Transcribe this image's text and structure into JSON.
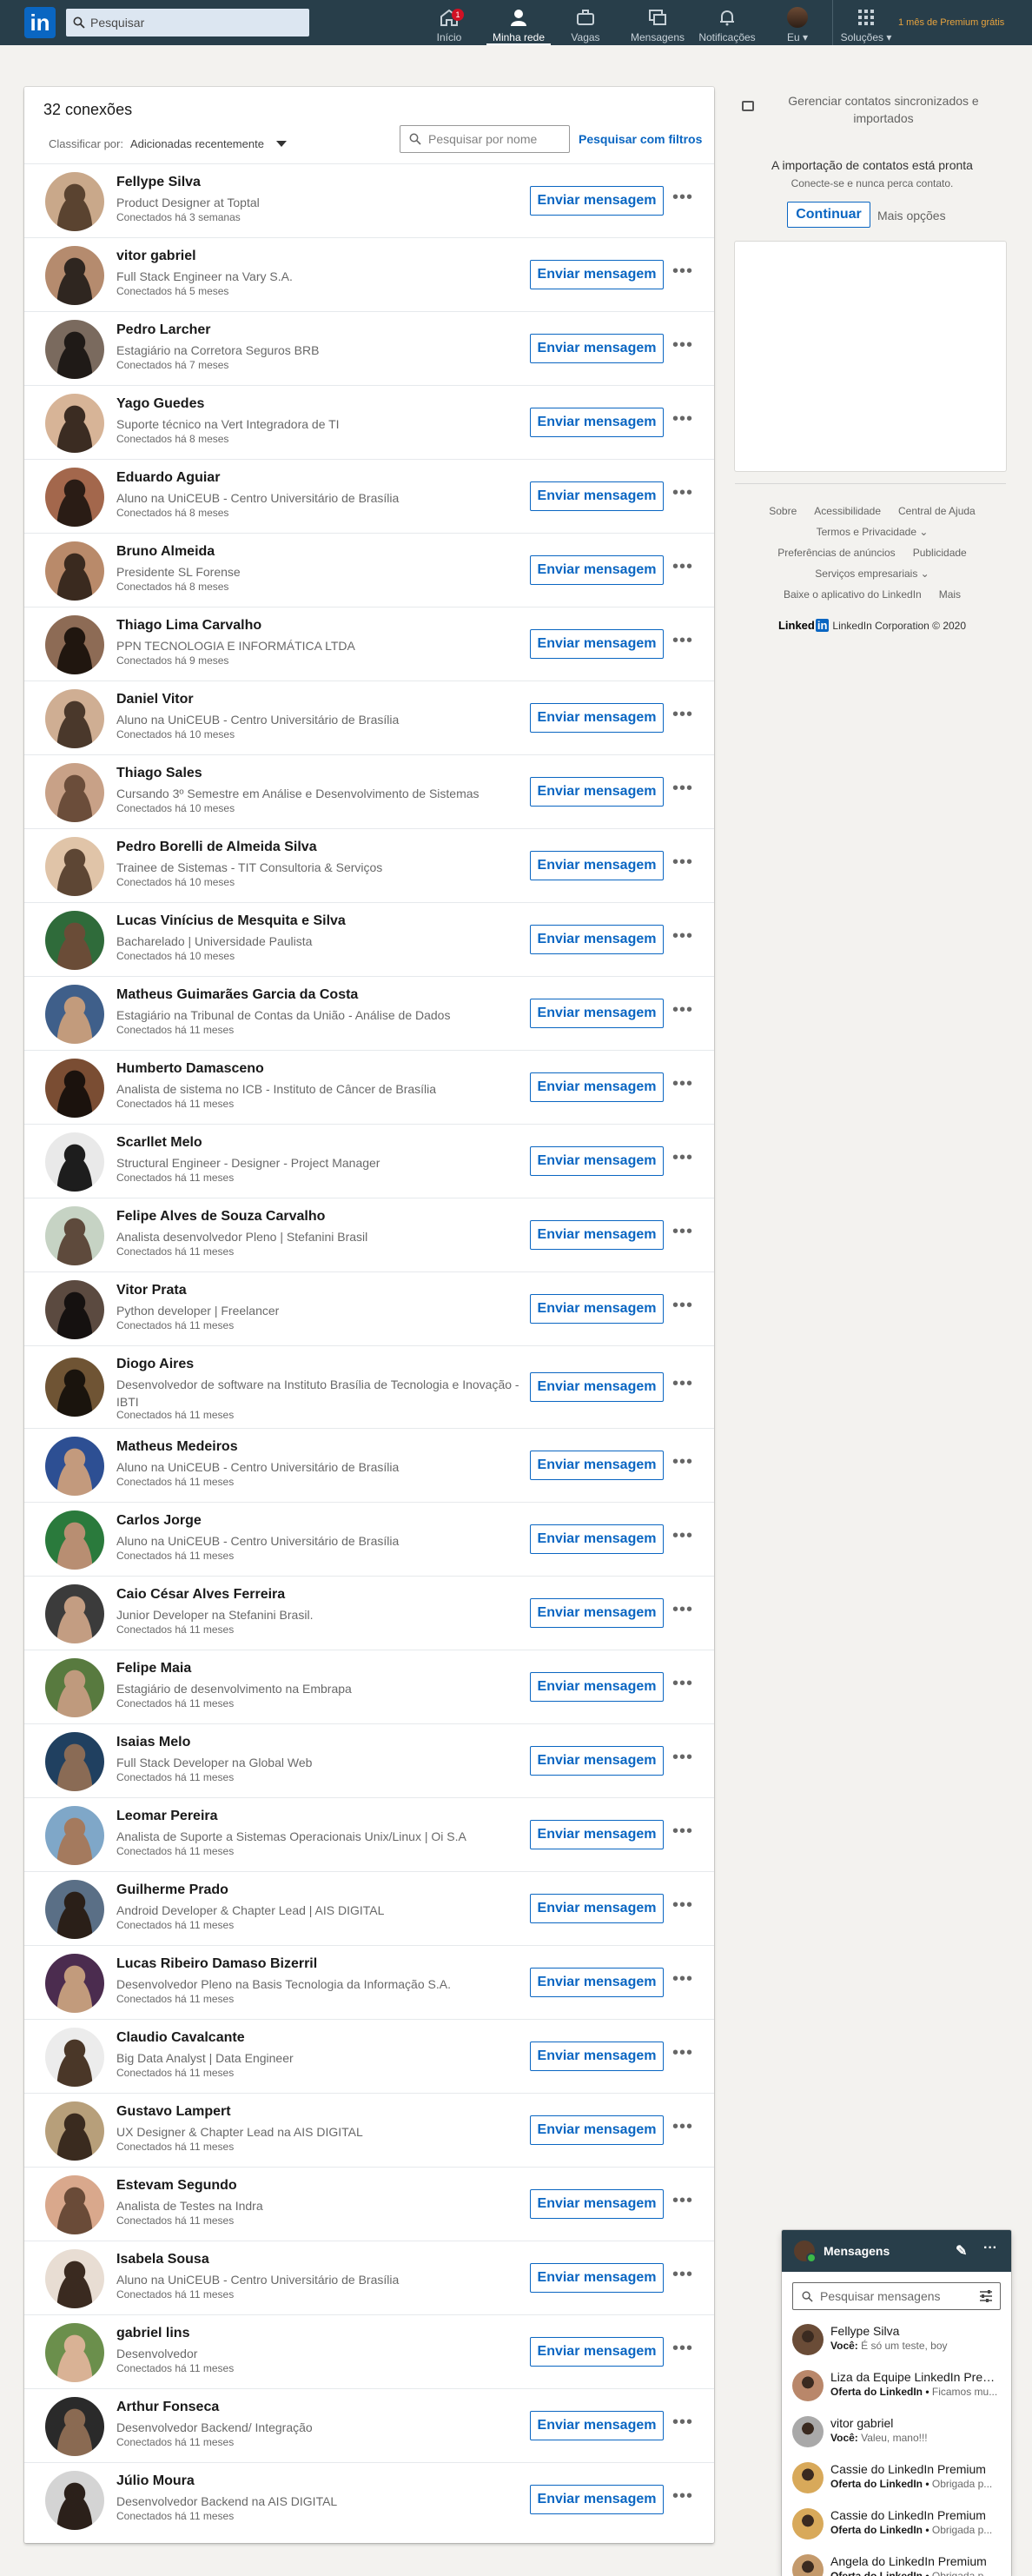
{
  "nav": {
    "logo": "in",
    "search_placeholder": "Pesquisar",
    "items": [
      {
        "label": "Início",
        "icon": "home-icon"
      },
      {
        "label": "Minha rede",
        "icon": "network-icon"
      },
      {
        "label": "Vagas",
        "icon": "briefcase-icon"
      },
      {
        "label": "Mensagens",
        "icon": "messaging-icon"
      },
      {
        "label": "Notificações",
        "icon": "bell-icon"
      },
      {
        "label": "Eu",
        "icon": "avatar"
      },
      {
        "label": "Soluções",
        "icon": "grid-icon"
      }
    ],
    "home_badge": "1",
    "premium": "1 mês de Premium grátis"
  },
  "connections": {
    "count_label": "32 conexões",
    "sort_label": "Classificar por:",
    "sort_value": "Adicionadas recentemente",
    "search_placeholder": "Pesquisar por nome",
    "filter_link": "Pesquisar com filtros",
    "message_button": "Enviar mensagem",
    "more": "•••",
    "list": [
      {
        "name": "Fellype Silva",
        "headline": "Product Designer at Toptal",
        "since": "Conectados há 3 semanas"
      },
      {
        "name": "vitor gabriel",
        "headline": "Full Stack Engineer na Vary S.A.",
        "since": "Conectados há 5 meses"
      },
      {
        "name": "Pedro Larcher",
        "headline": "Estagiário na Corretora Seguros BRB",
        "since": "Conectados há 7 meses"
      },
      {
        "name": "Yago Guedes",
        "headline": "Suporte técnico na Vert Integradora de TI",
        "since": "Conectados há 8 meses"
      },
      {
        "name": "Eduardo Aguiar",
        "headline": "Aluno na UniCEUB - Centro Universitário de Brasília",
        "since": "Conectados há 8 meses"
      },
      {
        "name": "Bruno Almeida",
        "headline": "Presidente SL Forense",
        "since": "Conectados há 8 meses"
      },
      {
        "name": "Thiago Lima Carvalho",
        "headline": "PPN TECNOLOGIA E INFORMÁTICA LTDA",
        "since": "Conectados há 9 meses"
      },
      {
        "name": "Daniel Vitor",
        "headline": "Aluno na UniCEUB - Centro Universitário de Brasília",
        "since": "Conectados há 10 meses"
      },
      {
        "name": "Thiago Sales",
        "headline": "Cursando 3º Semestre em Análise e Desenvolvimento de Sistemas",
        "since": "Conectados há 10 meses"
      },
      {
        "name": "Pedro Borelli de Almeida Silva",
        "headline": "Trainee de Sistemas - TIT Consultoria & Serviços",
        "since": "Conectados há 10 meses"
      },
      {
        "name": "Lucas Vinícius de Mesquita e Silva",
        "headline": "Bacharelado | Universidade Paulista",
        "since": "Conectados há 10 meses"
      },
      {
        "name": "Matheus Guimarães Garcia da Costa",
        "headline": "Estagiário na Tribunal de Contas da União - Análise de Dados",
        "since": "Conectados há 11 meses"
      },
      {
        "name": "Humberto Damasceno",
        "headline": "Analista de sistema no ICB - Instituto de Câncer de Brasília",
        "since": "Conectados há 11 meses"
      },
      {
        "name": "Scarllet Melo",
        "headline": "Structural Engineer - Designer - Project Manager",
        "since": "Conectados há 11 meses"
      },
      {
        "name": "Felipe Alves de Souza Carvalho",
        "headline": "Analista desenvolvedor Pleno | Stefanini Brasil",
        "since": "Conectados há 11 meses"
      },
      {
        "name": "Vitor Prata",
        "headline": "Python developer | Freelancer",
        "since": "Conectados há 11 meses"
      },
      {
        "name": "Diogo Aires",
        "headline": "Desenvolvedor de software na Instituto Brasília de Tecnologia e Inovação - IBTI",
        "since": "Conectados há 11 meses"
      },
      {
        "name": "Matheus Medeiros",
        "headline": "Aluno na UniCEUB - Centro Universitário de Brasília",
        "since": "Conectados há 11 meses"
      },
      {
        "name": "Carlos Jorge",
        "headline": "Aluno na UniCEUB - Centro Universitário de Brasília",
        "since": "Conectados há 11 meses"
      },
      {
        "name": "Caio César Alves Ferreira",
        "headline": "Junior Developer na Stefanini Brasil.",
        "since": "Conectados há 11 meses"
      },
      {
        "name": "Felipe Maia",
        "headline": "Estagiário de desenvolvimento na Embrapa",
        "since": "Conectados há 11 meses"
      },
      {
        "name": "Isaias Melo",
        "headline": "Full Stack Developer na Global Web",
        "since": "Conectados há 11 meses"
      },
      {
        "name": "Leomar Pereira",
        "headline": "Analista de Suporte a Sistemas Operacionais Unix/Linux | Oi S.A",
        "since": "Conectados há 11 meses"
      },
      {
        "name": "Guilherme Prado",
        "headline": "Android Developer & Chapter Lead | AIS DIGITAL",
        "since": "Conectados há 11 meses"
      },
      {
        "name": "Lucas Ribeiro Damaso Bizerril",
        "headline": "Desenvolvedor Pleno na Basis Tecnologia da Informação S.A.",
        "since": "Conectados há 11 meses"
      },
      {
        "name": "Claudio Cavalcante",
        "headline": "Big Data Analyst | Data Engineer",
        "since": "Conectados há 11 meses"
      },
      {
        "name": "Gustavo Lampert",
        "headline": "UX Designer & Chapter Lead na AIS DIGITAL",
        "since": "Conectados há 11 meses"
      },
      {
        "name": "Estevam Segundo",
        "headline": "Analista de Testes na Indra",
        "since": "Conectados há 11 meses"
      },
      {
        "name": "Isabela Sousa",
        "headline": "Aluno na UniCEUB - Centro Universitário de Brasília",
        "since": "Conectados há 11 meses"
      },
      {
        "name": "gabriel lins",
        "headline": "Desenvolvedor",
        "since": "Conectados há 11 meses"
      },
      {
        "name": "Arthur Fonseca",
        "headline": "Desenvolvedor Backend/ Integração",
        "since": "Conectados há 11 meses"
      },
      {
        "name": "Júlio Moura",
        "headline": "Desenvolvedor Backend na AIS DIGITAL",
        "since": "Conectados há 11 meses"
      }
    ]
  },
  "sidebar": {
    "contacts_title": "Gerenciar contatos sincronizados e importados",
    "import_title": "A importação de contatos está pronta",
    "import_sub": "Conecte-se e nunca perca contato.",
    "continue": "Continuar",
    "more_options": "Mais opções",
    "footer_lines": [
      [
        "Sobre",
        "Acessibilidade",
        "Central de Ajuda"
      ],
      [
        "Termos e Privacidade ⌄"
      ],
      [
        "Preferências de anúncios",
        "Publicidade"
      ],
      [
        "Serviços empresariais ⌄"
      ],
      [
        "Baixe o aplicativo do LinkedIn",
        "Mais"
      ]
    ],
    "copyright": "LinkedIn Corporation © 2020",
    "copyright_logo": "Linked"
  },
  "messaging": {
    "title": "Mensagens",
    "search_placeholder": "Pesquisar mensagens",
    "conversations": [
      {
        "name": "Fellype Silva",
        "sender": "Você:",
        "preview": " É só um teste, boy"
      },
      {
        "name": "Liza da Equipe LinkedIn Premium",
        "sender": "Oferta do LinkedIn •",
        "preview": " Ficamos mu..."
      },
      {
        "name": "vitor gabriel",
        "sender": "Você:",
        "preview": " Valeu, mano!!!"
      },
      {
        "name": "Cassie do LinkedIn Premium",
        "sender": "Oferta do LinkedIn •",
        "preview": " Obrigada p..."
      },
      {
        "name": "Cassie do LinkedIn Premium",
        "sender": "Oferta do LinkedIn •",
        "preview": " Obrigada p..."
      },
      {
        "name": "Angela do LinkedIn Premium",
        "sender": "Oferta do LinkedIn •",
        "preview": " Obrigada p..."
      }
    ]
  },
  "colors": {
    "nav": "#283e4a",
    "accent": "#0a66c2",
    "background": "#f3f2ef"
  }
}
